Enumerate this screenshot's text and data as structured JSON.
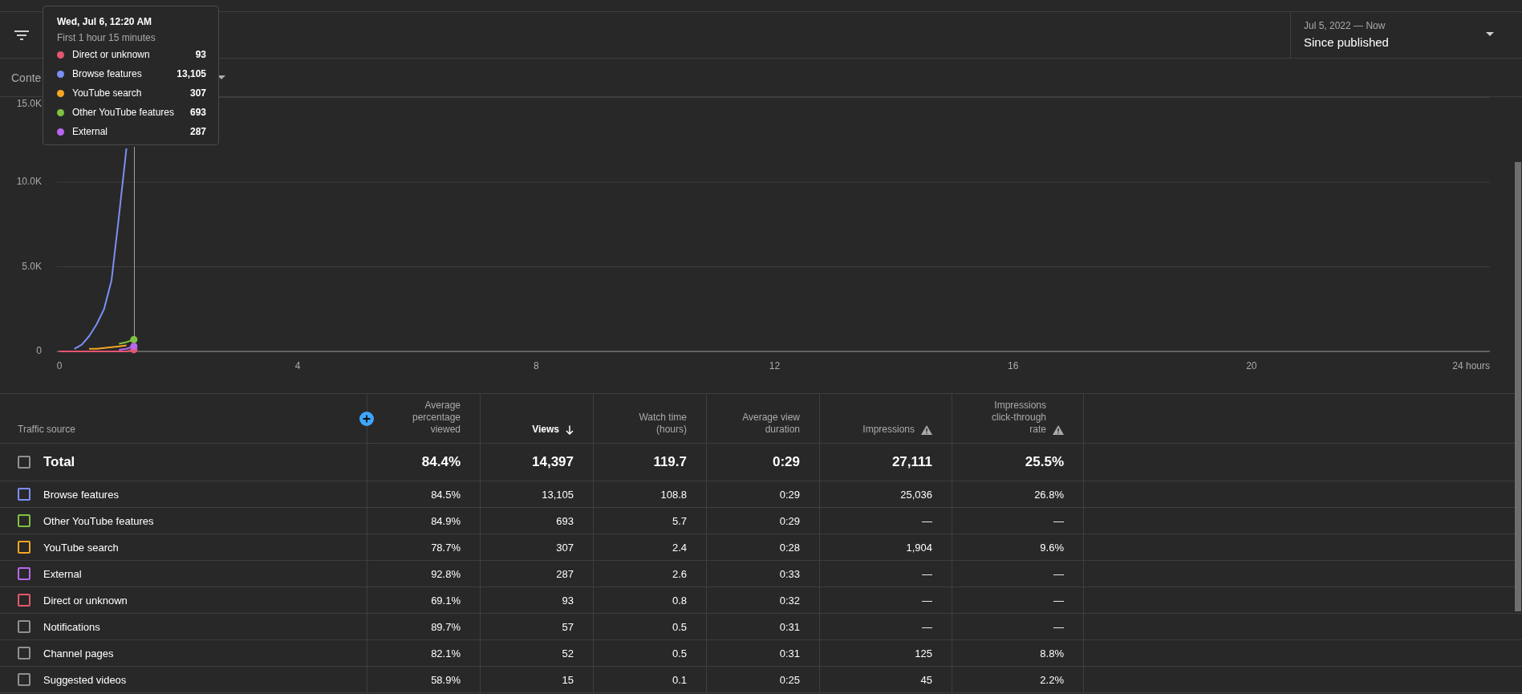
{
  "filter_bar": {
    "date_range": "Jul 5, 2022 — Now",
    "period": "Since published"
  },
  "content_row": {
    "dropdown": "Conte"
  },
  "tooltip": {
    "title": "Wed, Jul 6, 12:20 AM",
    "subtitle": "First 1 hour 15 minutes",
    "values": [
      "93",
      "13,105",
      "307",
      "693",
      "287"
    ]
  },
  "chart": {
    "chart_data": {
      "type": "line",
      "x": [
        0,
        0.125,
        0.25,
        0.375,
        0.5,
        0.625,
        0.75,
        0.875,
        1,
        1.125,
        1.25
      ],
      "series": [
        {
          "name": "Direct or unknown",
          "color": "#e5566f",
          "values": [
            0,
            0,
            0,
            0,
            0,
            0,
            0,
            0,
            0,
            0,
            100
          ]
        },
        {
          "name": "Browse features",
          "color": "#7c8ff5",
          "values": [
            null,
            null,
            150,
            400,
            900,
            1600,
            2500,
            4200,
            8000,
            12000,
            null
          ]
        },
        {
          "name": "YouTube search",
          "color": "#f5a623",
          "values": [
            null,
            null,
            null,
            null,
            150,
            150,
            200,
            250,
            300,
            350,
            null
          ]
        },
        {
          "name": "Other YouTube features",
          "color": "#7fc241",
          "values": [
            null,
            null,
            null,
            null,
            null,
            null,
            null,
            null,
            450,
            550,
            700
          ]
        },
        {
          "name": "External",
          "color": "#b867f0",
          "values": [
            null,
            null,
            null,
            null,
            null,
            null,
            null,
            null,
            100,
            150,
            300
          ]
        }
      ],
      "xlim": [
        0,
        24
      ],
      "ylim": [
        0,
        15000
      ],
      "xticks": [
        0,
        4,
        8,
        12,
        16,
        20,
        {
          "value": 24,
          "label": "24 hours"
        }
      ],
      "yticks": [
        {
          "value": 0,
          "label": "0"
        },
        {
          "value": 5000,
          "label": "5.0K"
        },
        {
          "value": 10000,
          "label": "10.0K"
        },
        {
          "value": 15000,
          "label": "15.0K"
        }
      ],
      "ref_lines": [
        {
          "axis": "x",
          "value": 1.25
        }
      ]
    }
  },
  "table": {
    "columns": [
      {
        "label": "Traffic source",
        "sorted": false,
        "warning": false
      },
      {
        "label": "Average percentage viewed",
        "sorted": false,
        "warning": false
      },
      {
        "label": "Views",
        "sorted": true,
        "warning": false
      },
      {
        "label": "Watch time (hours)",
        "sorted": false,
        "warning": false
      },
      {
        "label": "Average view duration",
        "sorted": false,
        "warning": false
      },
      {
        "label": "Impressions",
        "sorted": false,
        "warning": true
      },
      {
        "label": "Impressions click-through rate",
        "sorted": false,
        "warning": true
      }
    ],
    "rows": [
      {
        "kind": "total",
        "color": "#909090",
        "checked": false,
        "cells": [
          "Total",
          "84.4%",
          "14,397",
          "119.7",
          "0:29",
          "27,111",
          "25.5%"
        ]
      },
      {
        "kind": "source",
        "color": "#7c8ff5",
        "checked": false,
        "cells": [
          "Browse features",
          "84.5%",
          "13,105",
          "108.8",
          "0:29",
          "25,036",
          "26.8%"
        ]
      },
      {
        "kind": "source",
        "color": "#7fc241",
        "checked": false,
        "cells": [
          "Other YouTube features",
          "84.9%",
          "693",
          "5.7",
          "0:29",
          "—",
          "—"
        ]
      },
      {
        "kind": "source",
        "color": "#f5a623",
        "checked": false,
        "cells": [
          "YouTube search",
          "78.7%",
          "307",
          "2.4",
          "0:28",
          "1,904",
          "9.6%"
        ]
      },
      {
        "kind": "source",
        "color": "#b867f0",
        "checked": false,
        "cells": [
          "External",
          "92.8%",
          "287",
          "2.6",
          "0:33",
          "—",
          "—"
        ]
      },
      {
        "kind": "source",
        "color": "#e5566f",
        "checked": false,
        "cells": [
          "Direct or unknown",
          "69.1%",
          "93",
          "0.8",
          "0:32",
          "—",
          "—"
        ]
      },
      {
        "kind": "source",
        "color": "#909090",
        "checked": false,
        "cells": [
          "Notifications",
          "89.7%",
          "57",
          "0.5",
          "0:31",
          "—",
          "—"
        ]
      },
      {
        "kind": "source",
        "color": "#909090",
        "checked": false,
        "cells": [
          "Channel pages",
          "82.1%",
          "52",
          "0.5",
          "0:31",
          "125",
          "8.8%"
        ]
      },
      {
        "kind": "source",
        "color": "#909090",
        "checked": false,
        "cells": [
          "Suggested videos",
          "58.9%",
          "15",
          "0.1",
          "0:25",
          "45",
          "2.2%"
        ]
      }
    ]
  }
}
